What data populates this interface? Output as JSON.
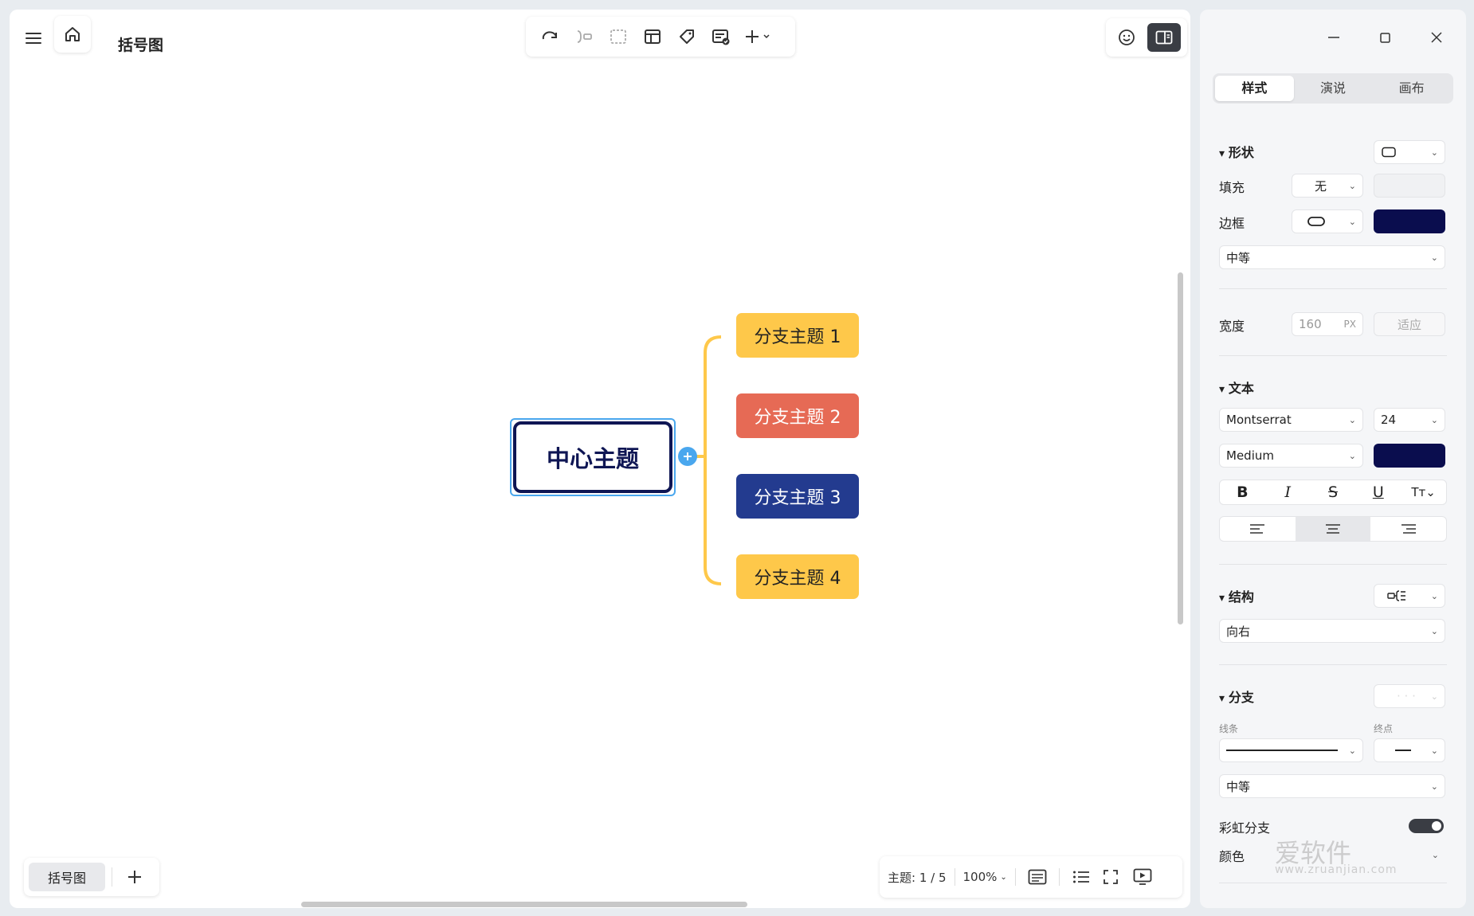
{
  "document": {
    "title": "括号图"
  },
  "mindmap": {
    "central_topic": "中心主题",
    "branches": [
      {
        "label": "分支主题 1",
        "color": "#fec84a",
        "text_color": "#222222"
      },
      {
        "label": "分支主题 2",
        "color": "#e66a55",
        "text_color": "#ffffff"
      },
      {
        "label": "分支主题 3",
        "color": "#233b8f",
        "text_color": "#ffffff"
      },
      {
        "label": "分支主题 4",
        "color": "#fec84a",
        "text_color": "#222222"
      }
    ],
    "bracket_color": "#fec84a",
    "central_border_color": "#0f1654"
  },
  "sheet_tabs": [
    {
      "label": "括号图"
    }
  ],
  "status_bar": {
    "topic_count": "主题: 1 / 5",
    "zoom": "100%"
  },
  "side_panel": {
    "tabs": [
      "样式",
      "演说",
      "画布"
    ],
    "active_tab": "样式",
    "shape": {
      "section": "形状",
      "fill_label": "填充",
      "fill_value": "无",
      "border_label": "边框",
      "border_color": "#0a0d4e",
      "border_weight": "中等",
      "width_label": "宽度",
      "width_value": "160",
      "width_unit": "PX",
      "fit_label": "适应"
    },
    "text": {
      "section": "文本",
      "font": "Montserrat",
      "size": "24",
      "weight": "Medium",
      "color": "#0a0d4e"
    },
    "structure": {
      "section": "结构",
      "direction": "向右"
    },
    "branch": {
      "section": "分支",
      "line_label": "线条",
      "end_label": "终点",
      "weight": "中等",
      "rainbow_label": "彩虹分支",
      "color_label": "颜色"
    },
    "watermark": {
      "text": "爱软件",
      "sub": "www.zruanjian.com"
    }
  }
}
